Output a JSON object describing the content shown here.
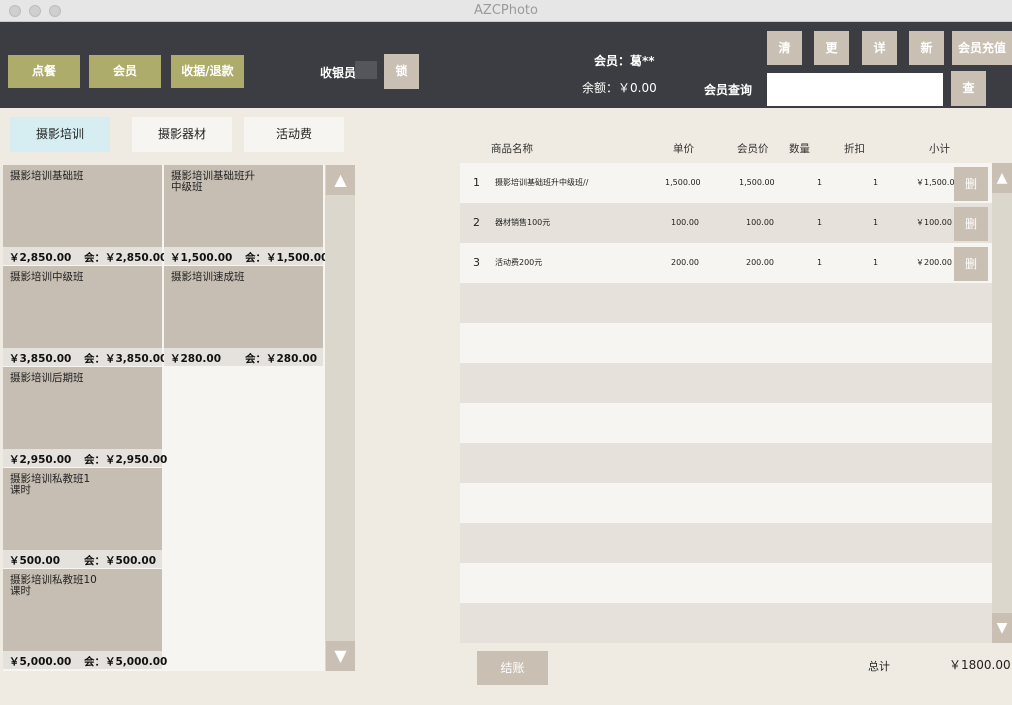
{
  "window": {
    "title": "AZCPhoto"
  },
  "toolbar": {
    "order_label": "点餐",
    "member_label": "会员",
    "receipt_refund_label": "收据/退款",
    "cashier_label": "收银员",
    "lock_label": "锁",
    "member_name": "会员：葛**",
    "balance": "余额：￥0.00",
    "clear_label": "清",
    "change_label": "更",
    "detail_label": "详",
    "new_label": "新",
    "recharge_label": "会员充值",
    "member_query_label": "会员查询",
    "member_query_value": "",
    "query_label": "查"
  },
  "tabs": [
    {
      "label": "摄影培训"
    },
    {
      "label": "摄影器材"
    },
    {
      "label": "活动费"
    }
  ],
  "products": [
    {
      "name": "摄影培训基础班",
      "price": "￥2,850.00",
      "member_price": "会：￥2,850.00"
    },
    {
      "name": "摄影培训基础班升中级班",
      "price": "￥1,500.00",
      "member_price": "会：￥1,500.00"
    },
    {
      "name": "摄影培训中级班",
      "price": "￥3,850.00",
      "member_price": "会：￥3,850.00"
    },
    {
      "name": "摄影培训速成班",
      "price": "￥280.00",
      "member_price": "会：￥280.00"
    },
    {
      "name": "摄影培训后期班",
      "price": "￥2,950.00",
      "member_price": "会：￥2,950.00"
    },
    {
      "name": "摄影培训私教班1课时",
      "price": "￥500.00",
      "member_price": "会：￥500.00"
    },
    {
      "name": "摄影培训私教班10课时",
      "price": "￥5,000.00",
      "member_price": "会：￥5,000.00"
    }
  ],
  "order_table": {
    "headers": {
      "name": "商品名称",
      "price": "单价",
      "member_price": "会员价",
      "qty": "数量",
      "discount": "折扣",
      "subtotal": "小计"
    },
    "rows": [
      {
        "no": "1",
        "name": "摄影培训基础班升中级班//",
        "price": "1,500.00",
        "member_price": "1,500.00",
        "qty": "1",
        "discount": "1",
        "subtotal": "￥1,500.00",
        "delete_label": "删"
      },
      {
        "no": "2",
        "name": "器材销售100元",
        "price": "100.00",
        "member_price": "100.00",
        "qty": "1",
        "discount": "1",
        "subtotal": "￥100.00",
        "delete_label": "删"
      },
      {
        "no": "3",
        "name": "活动费200元",
        "price": "200.00",
        "member_price": "200.00",
        "qty": "1",
        "discount": "1",
        "subtotal": "￥200.00",
        "delete_label": "删"
      }
    ]
  },
  "footer": {
    "checkout_label": "结账",
    "total_label": "总计",
    "total_value": "￥1800.00"
  },
  "icons": {
    "scroll_up": "triangle-up-icon",
    "scroll_down": "triangle-down-icon"
  },
  "colors": {
    "topbar": "#3c3d42",
    "olive_button": "#adac6a",
    "gray_button": "#c9c0b3",
    "tile": "#c7beb3",
    "active_tab": "#d6eef2"
  }
}
